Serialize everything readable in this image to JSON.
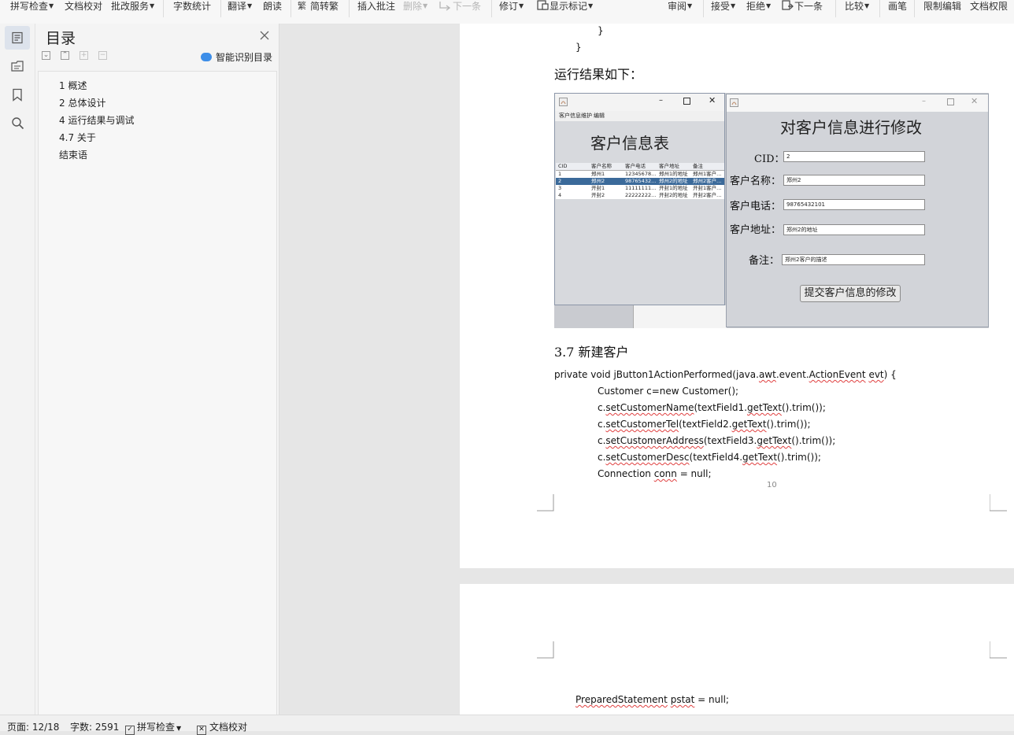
{
  "toolbar": {
    "spell_check": "拼写检查",
    "doc_proof": "文档校对",
    "revise_service": "批改服务",
    "word_count": "字数统计",
    "translate": "翻译",
    "read_aloud": "朗读",
    "simp_trad": "简转繁",
    "insert_comment": "插入批注",
    "delete": "删除",
    "next": "下一条",
    "revisions": "修订",
    "show_markup": "显示标记",
    "review": "审阅",
    "accept": "接受",
    "reject": "拒绝",
    "next2": "下一条",
    "compare": "比较",
    "ink": "画笔",
    "restrict_edit": "限制编辑",
    "doc_permission": "文档权限"
  },
  "toc": {
    "title": "目录",
    "smart_label": "智能识别目录",
    "items": [
      "1 概述",
      "2 总体设计",
      "4 运行结果与调试",
      "4.7 关于",
      "结束语"
    ]
  },
  "doc": {
    "brace1": "}",
    "brace2": "}",
    "run_result": "运行结果如下：",
    "section": "3.7 新建客户",
    "page_number": "10",
    "code": {
      "l1_a": "private void jButton1ActionPerformed(java.",
      "l1_b": "awt",
      "l1_c": ".event.",
      "l1_d": "ActionEvent",
      "l1_e": " ",
      "l1_f": "evt",
      "l1_g": ") {",
      "l2": "Customer c=new Customer();",
      "l3_a": "c.",
      "l3_b": "setCustomerName",
      "l3_c": "(textField1.",
      "l3_d": "getText",
      "l3_e": "().trim());",
      "l4_a": "c.",
      "l4_b": "setCustomerTel",
      "l4_c": "(textField2.",
      "l4_d": "getText",
      "l4_e": "().trim());",
      "l5_a": "c.",
      "l5_b": "setCustomerAddress",
      "l5_c": "(textField3.",
      "l5_d": "getText",
      "l5_e": "().trim());",
      "l6_a": "c.",
      "l6_b": "setCustomerDesc",
      "l6_c": "(textField4.",
      "l6_d": "getText",
      "l6_e": "().trim());",
      "l7_a": "Connection ",
      "l7_b": "conn",
      "l7_c": " = null;",
      "l8_a": "PreparedStatement",
      "l8_b": " ",
      "l8_c": "pstat",
      "l8_d": " = null;"
    }
  },
  "figure": {
    "win1_menu": [
      "客户信息维护",
      "编辑"
    ],
    "win1_title": "客户信息表",
    "table_headers": [
      "CID",
      "客户名称",
      "客户电话",
      "客户地址",
      "备注"
    ],
    "table_rows": [
      [
        "1",
        "郑州1",
        "12345678...",
        "郑州1的地址",
        "郑州1客户..."
      ],
      [
        "2",
        "郑州2",
        "98765432...",
        "郑州2的地址",
        "郑州2客户..."
      ],
      [
        "3",
        "开封1",
        "11111111...",
        "开封1的地址",
        "开封1客户..."
      ],
      [
        "4",
        "开封2",
        "22222222...",
        "开封2的地址",
        "开封2客户..."
      ]
    ],
    "win2_title": "对客户信息进行修改",
    "labels": [
      "CID：",
      "客户名称：",
      "客户电话：",
      "客户地址：",
      "备注："
    ],
    "values": [
      "2",
      "郑州2",
      "98765432101",
      "郑州2的地址",
      "郑州2客户的描述"
    ],
    "submit": "提交客户信息的修改"
  },
  "status": {
    "page": "页面: 12/18",
    "words": "字数: 2591",
    "spell": "拼写检查",
    "proof": "文档校对"
  },
  "colors": {
    "accent": "#3d8ee8",
    "selected_row": "#3b6a9a",
    "squiggle": "#e04040"
  }
}
